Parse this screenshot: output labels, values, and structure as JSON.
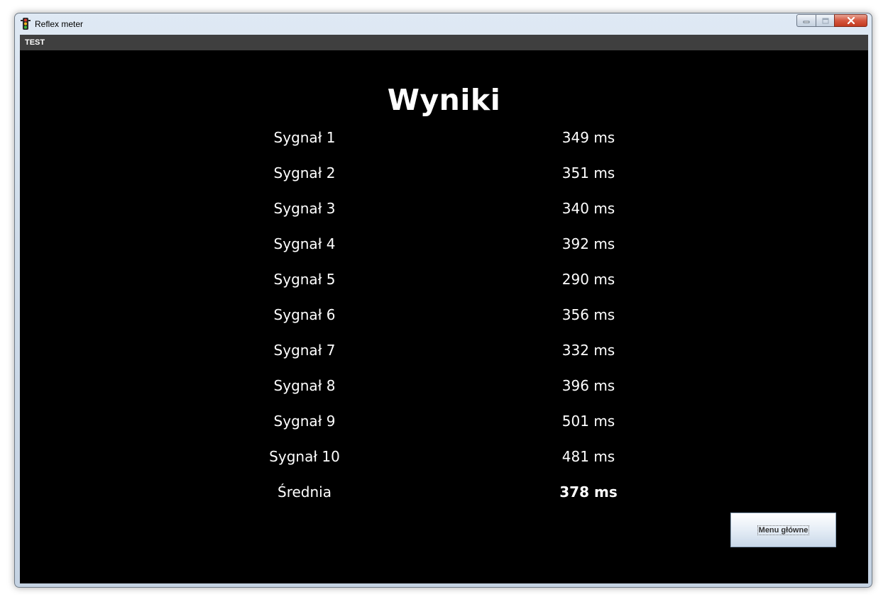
{
  "window": {
    "title": "Reflex meter"
  },
  "menubar": {
    "items": [
      "TEST"
    ]
  },
  "results": {
    "heading": "Wyniki",
    "rows": [
      {
        "label": "Sygnał 1",
        "value": "349 ms"
      },
      {
        "label": "Sygnał 2",
        "value": "351 ms"
      },
      {
        "label": "Sygnał 3",
        "value": "340 ms"
      },
      {
        "label": "Sygnał 4",
        "value": "392 ms"
      },
      {
        "label": "Sygnał 5",
        "value": "290 ms"
      },
      {
        "label": "Sygnał 6",
        "value": "356 ms"
      },
      {
        "label": "Sygnał 7",
        "value": "332 ms"
      },
      {
        "label": "Sygnał 8",
        "value": "396 ms"
      },
      {
        "label": "Sygnał 9",
        "value": "501 ms"
      },
      {
        "label": "Sygnał 10",
        "value": "481 ms"
      }
    ],
    "average": {
      "label": "Średnia",
      "value": "378 ms"
    }
  },
  "buttons": {
    "main_menu": "Menu główne"
  },
  "icons": {
    "app": "traffic-light-icon",
    "minimize": "minimize-icon",
    "maximize": "maximize-icon",
    "close": "close-icon"
  },
  "colors": {
    "background": "#000000",
    "menubar": "#3f3f3f",
    "text": "#ffffff",
    "close_button": "#c9462d"
  }
}
